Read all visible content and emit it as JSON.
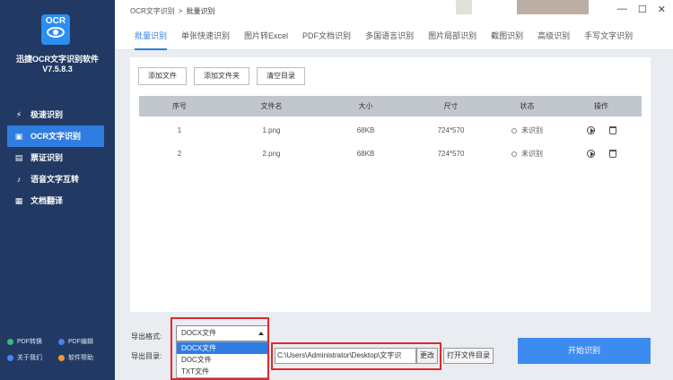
{
  "app": {
    "name": "迅捷OCR文字识别软件",
    "version": "V7.5.8.3",
    "logo_text": "OCR"
  },
  "breadcrumb": {
    "root": "OCR文字识别",
    "current": "批量识别",
    "separator": ">"
  },
  "window_controls": {
    "minimize": "—",
    "maximize": "☐",
    "close": "✕"
  },
  "sidebar": {
    "items": [
      {
        "label": "极速识别",
        "icon": "lightning-icon",
        "active": false
      },
      {
        "label": "OCR文字识别",
        "icon": "scan-icon",
        "active": true
      },
      {
        "label": "票证识别",
        "icon": "ticket-icon",
        "active": false
      },
      {
        "label": "语音文字互转",
        "icon": "microphone-icon",
        "active": false
      },
      {
        "label": "文档翻译",
        "icon": "translate-icon",
        "active": false
      }
    ],
    "links": [
      {
        "label": "PDF转换",
        "color": "#3cb878"
      },
      {
        "label": "PDF编辑",
        "color": "#4a7ff0"
      },
      {
        "label": "关于我们",
        "color": "#3d8bf0"
      },
      {
        "label": "软件帮助",
        "color": "#f29a2e"
      }
    ]
  },
  "tabs": [
    "批量识别",
    "单张快速识别",
    "图片转Excel",
    "PDF文档识别",
    "多国语言识别",
    "图片局部识别",
    "截图识别",
    "高级识别",
    "手写文字识别"
  ],
  "toolbar": {
    "add_file": "添加文件",
    "add_folder": "添加文件夹",
    "clear_list": "清空目录"
  },
  "table": {
    "columns": [
      "序号",
      "文件名",
      "大小",
      "尺寸",
      "状态",
      "操作"
    ],
    "rows": [
      {
        "index": "1",
        "name": "1.png",
        "size": "68KB",
        "dims": "724*570",
        "status": "未识别"
      },
      {
        "index": "2",
        "name": "2.png",
        "size": "68KB",
        "dims": "724*570",
        "status": "未识别"
      }
    ]
  },
  "export": {
    "format_label": "导出格式:",
    "format_value": "DOCX文件",
    "format_options": [
      "DOCX文件",
      "DOC文件",
      "TXT文件"
    ],
    "dir_label": "导出目录:",
    "dir_value": "C:\\Users\\Administrator\\Desktop\\文字识",
    "change_label": "更改",
    "open_folder_label": "打开文件目录",
    "start_label": "开始识别"
  },
  "colors": {
    "sidebar_bg": "#223a63",
    "accent": "#2f7de0",
    "highlight": "#e0282e"
  }
}
